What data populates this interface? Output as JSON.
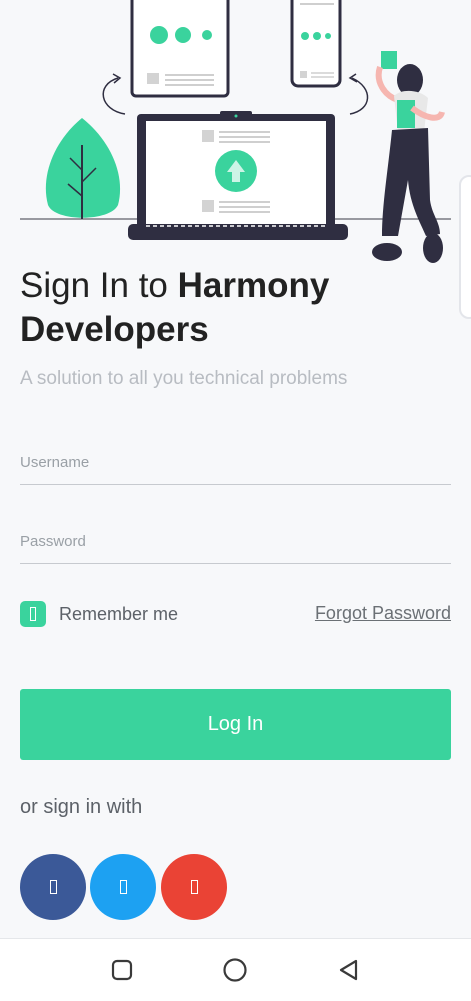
{
  "header": {
    "title_prefix": "Sign In to ",
    "title_brand_line1": "Harmony",
    "title_brand_line2": "Developers",
    "subtitle": "A solution to all you technical problems"
  },
  "form": {
    "username_placeholder": "Username",
    "username_value": "",
    "password_placeholder": "Password",
    "password_value": "",
    "remember_label": "Remember me",
    "remember_checked": true,
    "forgot_label": "Forgot Password",
    "login_label": "Log In"
  },
  "social": {
    "prompt": "or sign in with",
    "buttons": [
      {
        "name": "facebook",
        "color": "#3b5998"
      },
      {
        "name": "twitter",
        "color": "#1da1f2"
      },
      {
        "name": "google",
        "color": "#ea4335"
      }
    ]
  },
  "navbar": {
    "buttons": [
      "recents-square-icon",
      "home-circle-icon",
      "back-triangle-icon"
    ]
  },
  "colors": {
    "accent": "#3ad39d",
    "dark": "#2f2e41",
    "background": "#f7f8fa"
  }
}
